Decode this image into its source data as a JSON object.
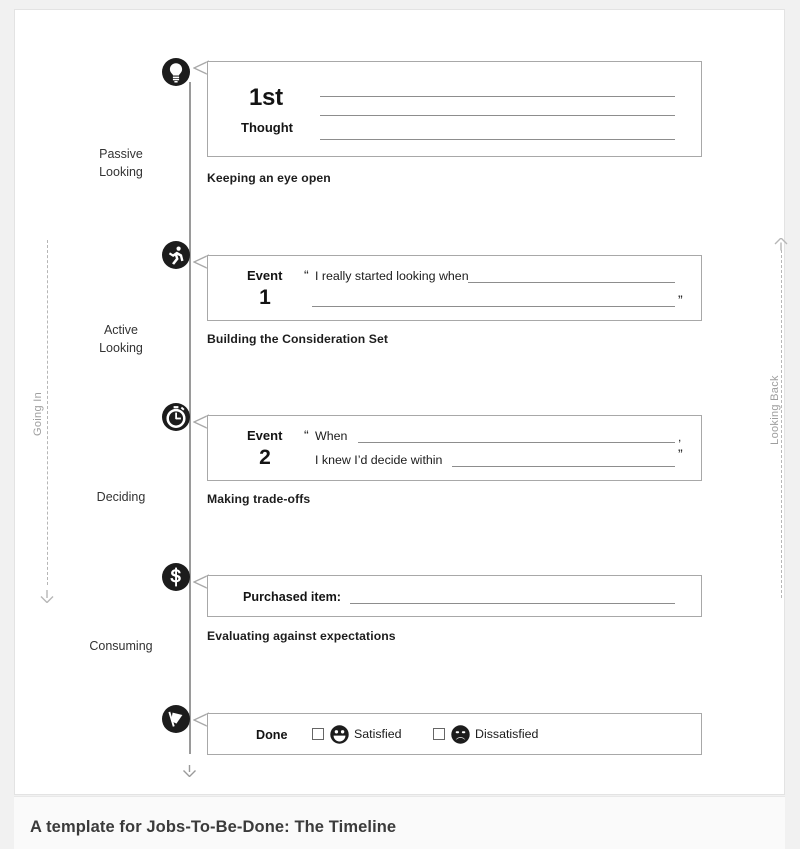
{
  "caption": "A template for Jobs-To-Be-Done: The Timeline",
  "rails": {
    "left": {
      "label": "Going In",
      "direction": "down"
    },
    "right": {
      "label": "Looking Back",
      "direction": "up"
    }
  },
  "stages": [
    {
      "line1": "Passive",
      "line2": "Looking"
    },
    {
      "line1": "Active",
      "line2": "Looking"
    },
    {
      "line1": "Deciding",
      "line2": ""
    },
    {
      "line1": "Consuming",
      "line2": ""
    }
  ],
  "rows": [
    {
      "icon": "lightbulb-icon",
      "ordinal": "1st",
      "ordinal_sub": "Thought",
      "subtitle": "Keeping an eye open",
      "lines": 3
    },
    {
      "icon": "running-person-icon",
      "event_word": "Event",
      "event_number": "1",
      "phrase": "I really started looking when",
      "open_quote": "“",
      "close_quote": "”",
      "subtitle": "Building the Consideration Set"
    },
    {
      "icon": "stopwatch-icon",
      "event_word": "Event",
      "event_number": "2",
      "phrase_1": "When",
      "phrase_2": "I knew I’d decide within",
      "open_quote": "“",
      "comma": ",",
      "close_quote": "”",
      "subtitle": "Making trade-offs"
    },
    {
      "icon": "dollar-coin-icon",
      "field_label": "Purchased item:",
      "subtitle": "Evaluating against expectations"
    },
    {
      "icon": "flag-icon",
      "done_label": "Done",
      "options": [
        {
          "face": "smiley-face-icon",
          "label": "Satisfied"
        },
        {
          "face": "frowny-face-icon",
          "label": "Dissatisfied"
        }
      ]
    }
  ],
  "colors": {
    "ink": "#141414",
    "node": "#1c1c1c",
    "rule": "#8d8d8d",
    "box_border": "#a8a8a8",
    "rail": "#b6b6b6",
    "page_bg": "#f1f1f1"
  }
}
